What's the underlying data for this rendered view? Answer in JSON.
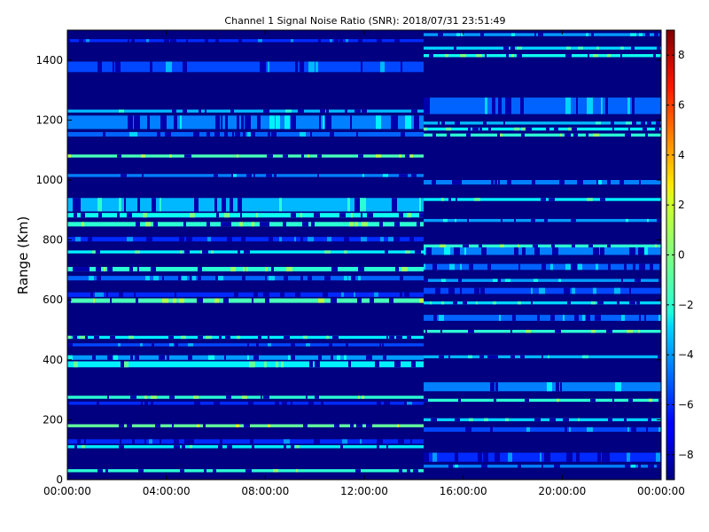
{
  "chart_data": {
    "type": "heatmap",
    "title": "Channel 1 Signal Noise Ratio (SNR): 2018/07/31 23:51:49",
    "xlabel": "",
    "ylabel": "Range (Km)",
    "x_tick_labels": [
      "00:00:00",
      "04:00:00",
      "08:00:00",
      "12:00:00",
      "16:00:00",
      "20:00:00",
      "00:00:00"
    ],
    "x_range_hours": [
      0,
      24
    ],
    "ylim": [
      0,
      1500
    ],
    "y_ticks": [
      0,
      200,
      400,
      600,
      800,
      1000,
      1200,
      1400
    ],
    "colorbar": {
      "colormap": "jet",
      "range": [
        -9,
        9
      ],
      "ticks": [
        -8,
        -6,
        -4,
        -2,
        0,
        2,
        4,
        6,
        8
      ]
    },
    "grid": false,
    "data_gap_start_hour": 14.4,
    "segments": [
      {
        "x_start_hour": 0,
        "x_end_hour": 14.4,
        "background_snr": -9,
        "bands": [
          {
            "range_km": [
              25,
              35
            ],
            "snr": -1.5
          },
          {
            "range_km": [
              105,
              115
            ],
            "snr": -2.5
          },
          {
            "range_km": [
              120,
              135
            ],
            "snr": -6
          },
          {
            "range_km": [
              175,
              185
            ],
            "snr": -0.5
          },
          {
            "range_km": [
              250,
              260
            ],
            "snr": -6
          },
          {
            "range_km": [
              270,
              280
            ],
            "snr": -1.5
          },
          {
            "range_km": [
              375,
              395
            ],
            "snr": -2.5
          },
          {
            "range_km": [
              400,
              415
            ],
            "snr": -4
          },
          {
            "range_km": [
              445,
              455
            ],
            "snr": -5.5
          },
          {
            "range_km": [
              470,
              480
            ],
            "snr": -2.5
          },
          {
            "range_km": [
              590,
              605
            ],
            "snr": -1
          },
          {
            "range_km": [
              610,
              625
            ],
            "snr": -6
          },
          {
            "range_km": [
              665,
              680
            ],
            "snr": -5
          },
          {
            "range_km": [
              695,
              710
            ],
            "snr": -1.5
          },
          {
            "range_km": [
              755,
              765
            ],
            "snr": -2.5
          },
          {
            "range_km": [
              795,
              810
            ],
            "snr": -6
          },
          {
            "range_km": [
              845,
              860
            ],
            "snr": -1.5
          },
          {
            "range_km": [
              875,
              890
            ],
            "snr": -2
          },
          {
            "range_km": [
              895,
              940
            ],
            "snr": -3.5
          },
          {
            "range_km": [
              1010,
              1020
            ],
            "snr": -4.5
          },
          {
            "range_km": [
              1075,
              1085
            ],
            "snr": -1
          },
          {
            "range_km": [
              1145,
              1160
            ],
            "snr": -5
          },
          {
            "range_km": [
              1170,
              1215
            ],
            "snr": -4.5
          },
          {
            "range_km": [
              1225,
              1235
            ],
            "snr": -3.5
          },
          {
            "range_km": [
              1360,
              1395
            ],
            "snr": -5.5
          },
          {
            "range_km": [
              1460,
              1470
            ],
            "snr": -6
          }
        ]
      },
      {
        "x_start_hour": 14.4,
        "x_end_hour": 24,
        "background_snr": -9,
        "bands": [
          {
            "range_km": [
              40,
              50
            ],
            "snr": -4.5
          },
          {
            "range_km": [
              60,
              90
            ],
            "snr": -6
          },
          {
            "range_km": [
              160,
              175
            ],
            "snr": -5.5
          },
          {
            "range_km": [
              195,
              205
            ],
            "snr": -3
          },
          {
            "range_km": [
              260,
              270
            ],
            "snr": -1.5
          },
          {
            "range_km": [
              295,
              325
            ],
            "snr": -4.5
          },
          {
            "range_km": [
              405,
              415
            ],
            "snr": -3.5
          },
          {
            "range_km": [
              490,
              500
            ],
            "snr": -1.5
          },
          {
            "range_km": [
              530,
              550
            ],
            "snr": -5
          },
          {
            "range_km": [
              585,
              595
            ],
            "snr": -3
          },
          {
            "range_km": [
              620,
              640
            ],
            "snr": -5.5
          },
          {
            "range_km": [
              660,
              670
            ],
            "snr": -4
          },
          {
            "range_km": [
              700,
              720
            ],
            "snr": -5
          },
          {
            "range_km": [
              750,
              775
            ],
            "snr": -4.5
          },
          {
            "range_km": [
              775,
              785
            ],
            "snr": -1.5
          },
          {
            "range_km": [
              860,
              870
            ],
            "snr": -4
          },
          {
            "range_km": [
              930,
              940
            ],
            "snr": -2.5
          },
          {
            "range_km": [
              985,
              1000
            ],
            "snr": -4.5
          },
          {
            "range_km": [
              1145,
              1155
            ],
            "snr": -1.5
          },
          {
            "range_km": [
              1165,
              1175
            ],
            "snr": -2.5
          },
          {
            "range_km": [
              1185,
              1195
            ],
            "snr": -3.5
          },
          {
            "range_km": [
              1220,
              1275
            ],
            "snr": -5
          },
          {
            "range_km": [
              1410,
              1420
            ],
            "snr": -2
          },
          {
            "range_km": [
              1435,
              1445
            ],
            "snr": -3
          },
          {
            "range_km": [
              1480,
              1490
            ],
            "snr": -4
          }
        ]
      }
    ]
  }
}
